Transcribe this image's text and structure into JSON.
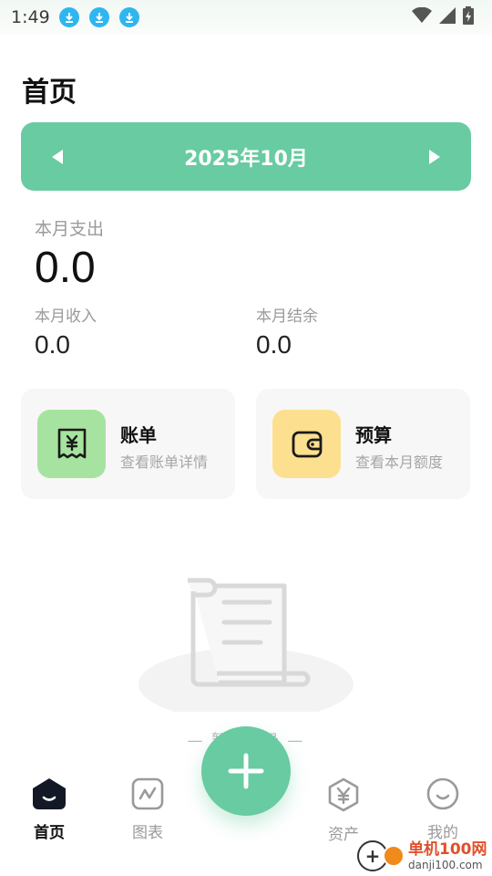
{
  "status_bar": {
    "time": "1:49",
    "icons": [
      "download-icon",
      "download-icon",
      "download-icon",
      "wifi-icon",
      "signal-icon",
      "battery-icon"
    ]
  },
  "page": {
    "title": "首页"
  },
  "month_selector": {
    "label": "2025年10月",
    "prev_icon": "triangle-left-icon",
    "next_icon": "triangle-right-icon"
  },
  "summary": {
    "expense_label": "本月支出",
    "expense_value": "0.0",
    "income_label": "本月收入",
    "income_value": "0.0",
    "balance_label": "本月结余",
    "balance_value": "0.0"
  },
  "cards": {
    "bill": {
      "title": "账单",
      "subtitle": "查看账单详情",
      "icon": "receipt-yen-icon"
    },
    "budget": {
      "title": "预算",
      "subtitle": "查看本月额度",
      "icon": "wallet-icon"
    }
  },
  "empty_state": {
    "text": "— 暂无记录 —",
    "icon": "scroll-icon"
  },
  "tab_bar": {
    "tabs": [
      {
        "label": "首页",
        "icon": "home-icon",
        "active": true
      },
      {
        "label": "图表",
        "icon": "chart-icon",
        "active": false
      },
      {
        "label": "资产",
        "icon": "yen-hexagon-icon",
        "active": false
      },
      {
        "label": "我的",
        "icon": "smile-icon",
        "active": false
      }
    ],
    "fab_icon": "plus-icon"
  },
  "watermark": {
    "brand": "单机100网",
    "url": "danji100.com"
  },
  "colors": {
    "accent": "#69cba1",
    "bill_icon_bg": "#a7e3a0",
    "budget_icon_bg": "#fde08f",
    "card_bg": "#f7f7f7"
  }
}
